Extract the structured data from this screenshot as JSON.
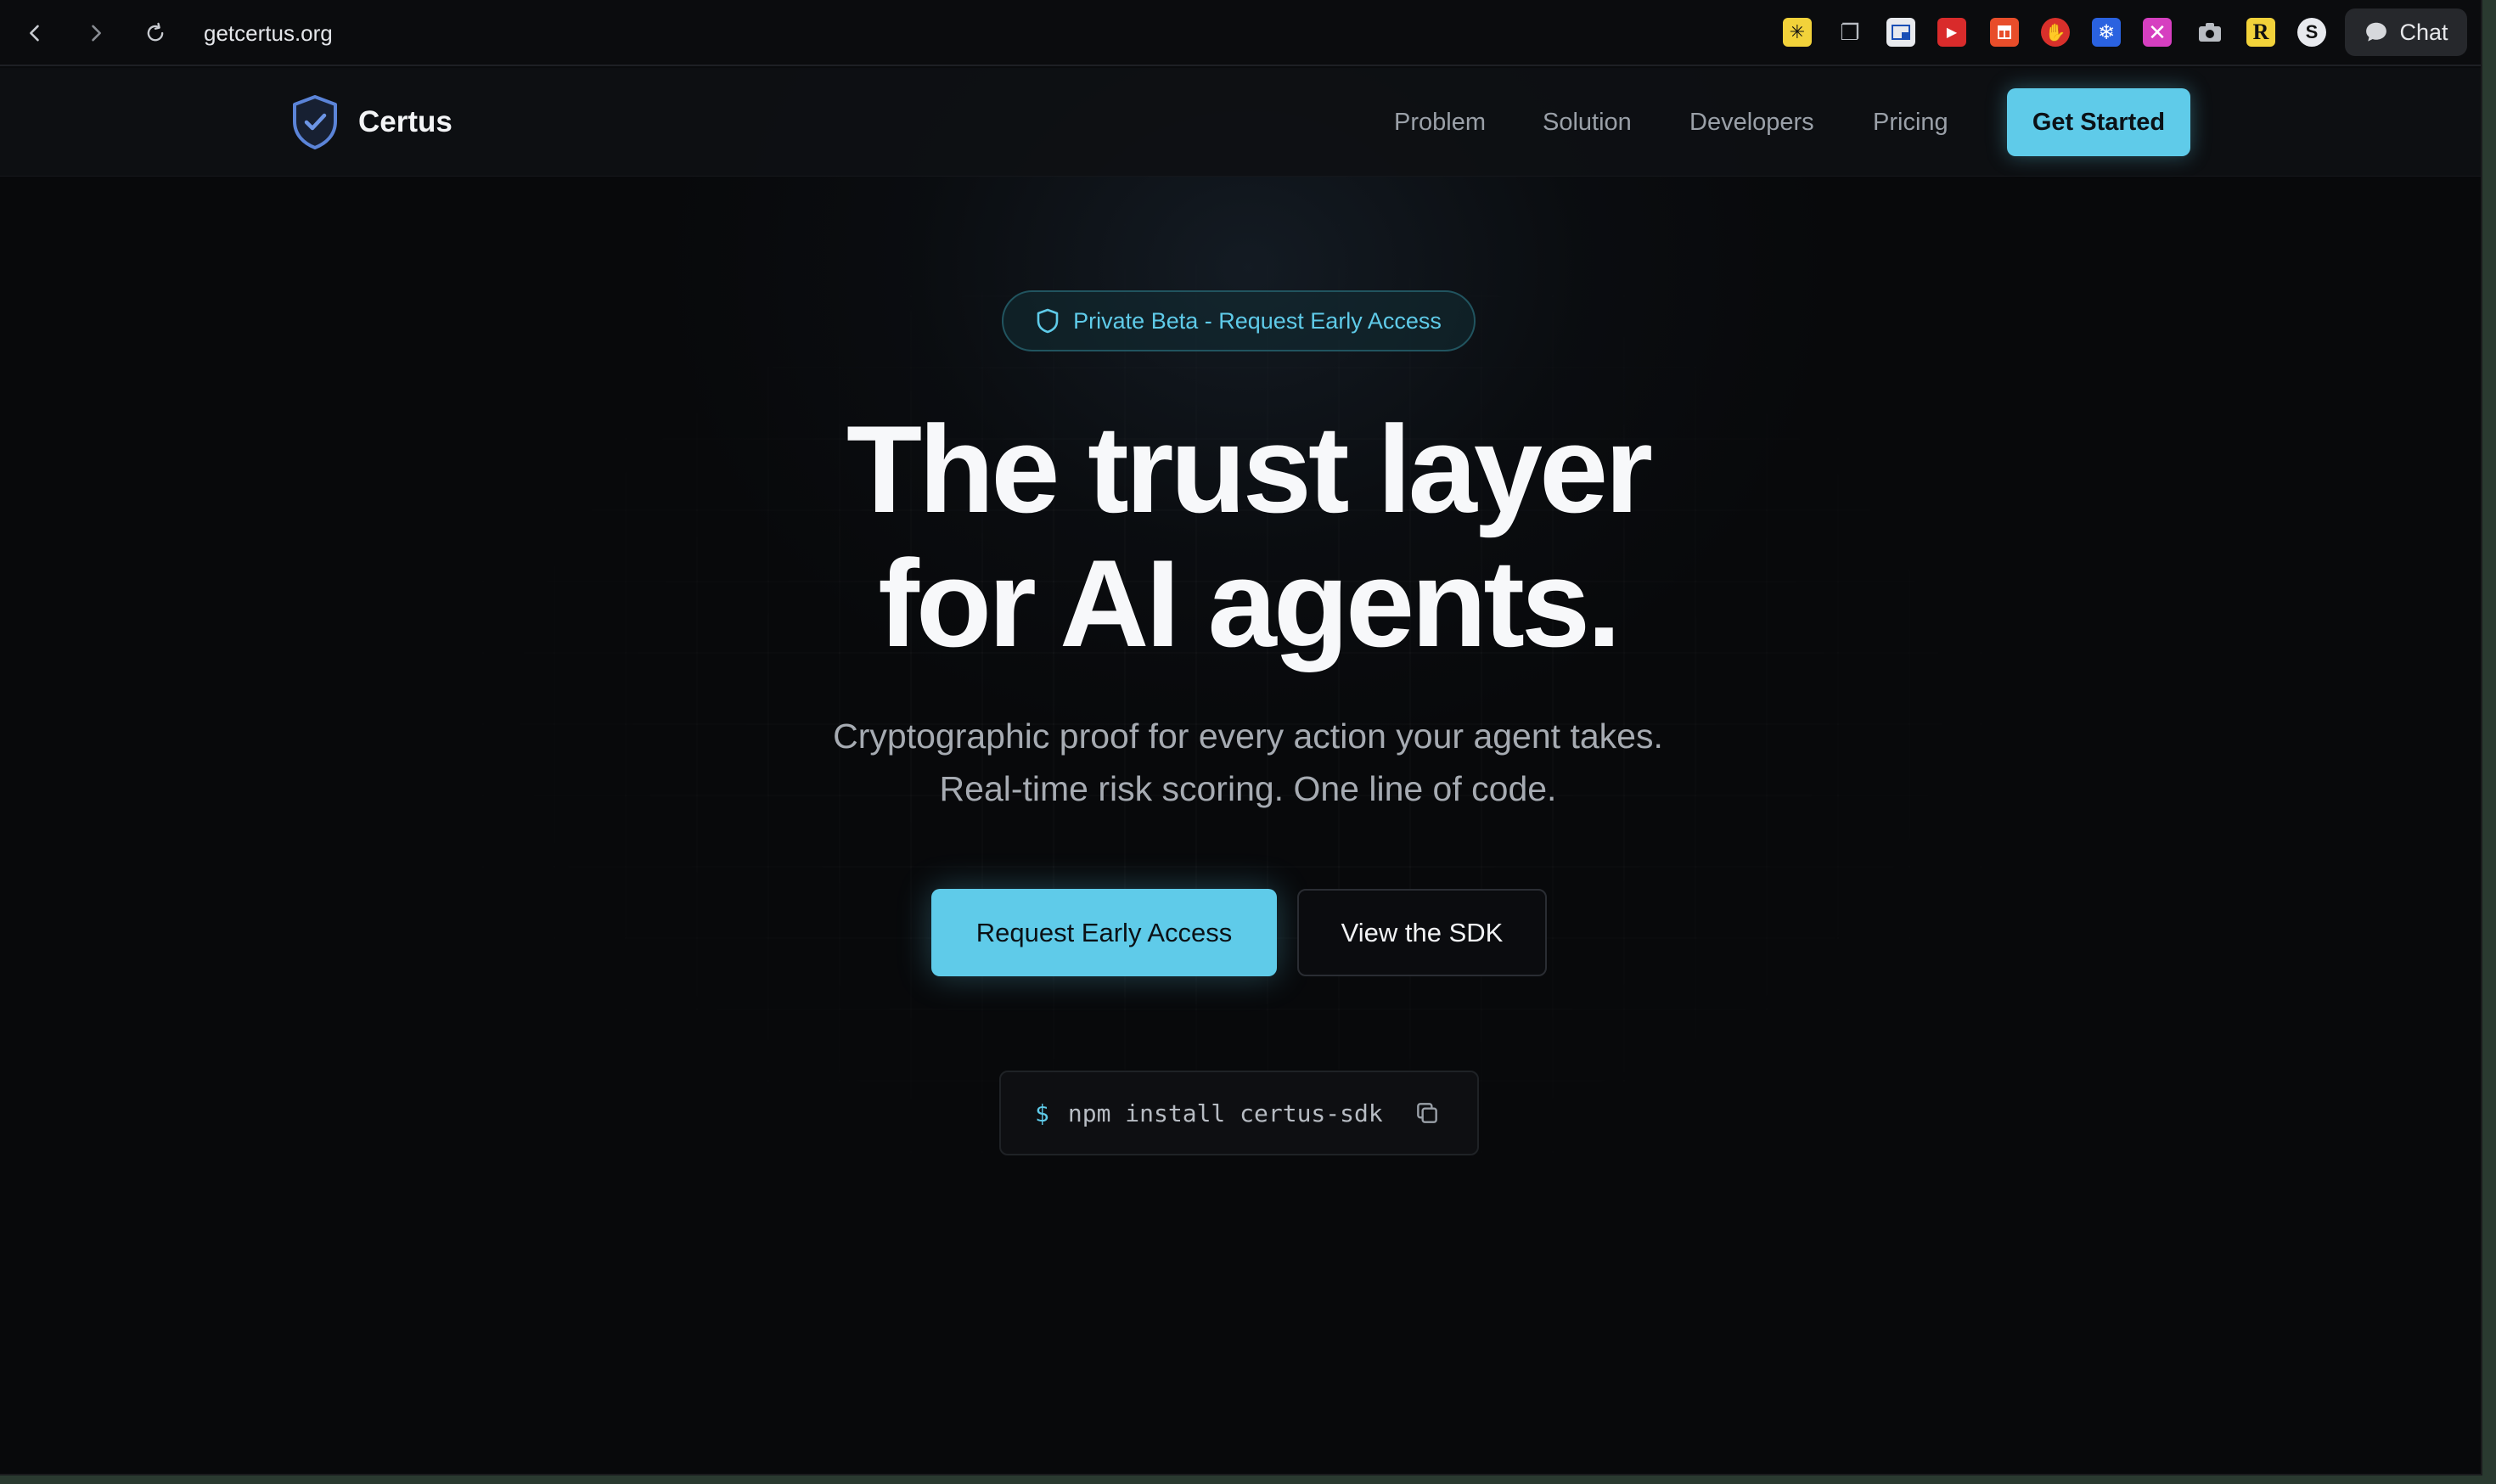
{
  "browser": {
    "url": "getcertus.org",
    "chat_label": "Chat"
  },
  "nav": {
    "brand": "Certus",
    "links": [
      "Problem",
      "Solution",
      "Developers",
      "Pricing"
    ],
    "cta": "Get Started"
  },
  "hero": {
    "badge": "Private Beta - Request Early Access",
    "headline_line1": "The trust layer",
    "headline_line2": "for AI agents.",
    "subtitle_line1": "Cryptographic proof for every action your agent takes.",
    "subtitle_line2": "Real-time risk scoring. One line of code.",
    "primary_button": "Request Early Access",
    "secondary_button": "View the SDK",
    "install_prompt": "$",
    "install_command": "npm install certus-sdk"
  },
  "colors": {
    "accent": "#5fcbe9",
    "background": "#08090b"
  }
}
